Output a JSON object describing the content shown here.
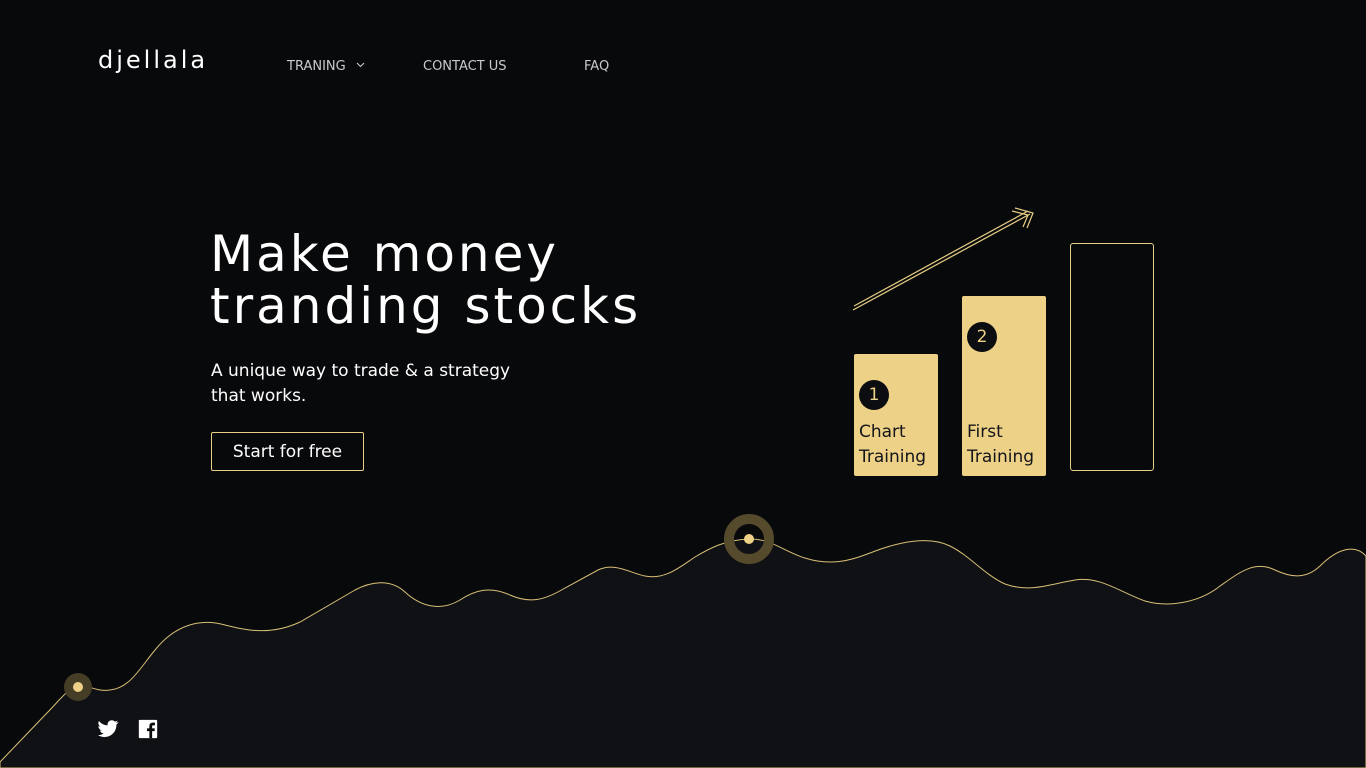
{
  "brand": {
    "logo": "djellala"
  },
  "nav": {
    "items": [
      {
        "label": "TRANING",
        "has_dropdown": true
      },
      {
        "label": "CONTACT US"
      },
      {
        "label": "FAQ"
      }
    ]
  },
  "hero": {
    "title_line1": "Make money",
    "title_line2": "tranding stocks",
    "subtitle_line1": "A unique way to trade & a strategy",
    "subtitle_line2": "that works.",
    "cta_label": "Start for free"
  },
  "steps": [
    {
      "number": "1",
      "label_line1": "Chart",
      "label_line2": "Training"
    },
    {
      "number": "2",
      "label_line1": "First",
      "label_line2": "Training"
    }
  ],
  "social": {
    "items": [
      {
        "icon": "twitter-icon"
      },
      {
        "icon": "facebook-icon"
      }
    ]
  },
  "colors": {
    "background": "#08090b",
    "accent": "#edd187",
    "wave_fill": "#0f1114"
  }
}
